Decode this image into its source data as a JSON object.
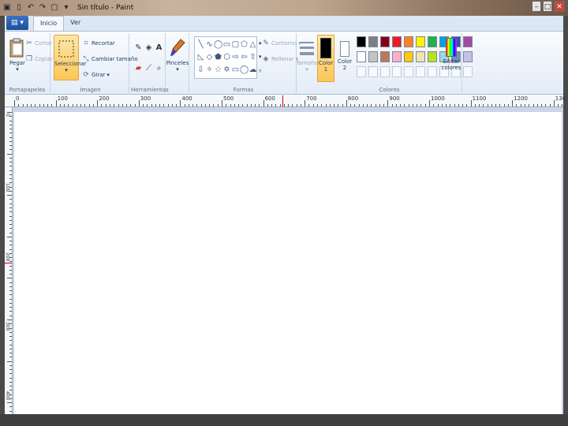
{
  "window": {
    "title": "Sin título - Paint",
    "controls": {
      "minimize": "–",
      "maximize": "□",
      "close": "✕"
    }
  },
  "tabs": {
    "file_icon": "▤ ▾",
    "items": [
      "Inicio",
      "Ver"
    ],
    "active": "Inicio"
  },
  "groups": {
    "clipboard": {
      "label": "Portapapeles",
      "paste": "Pegar",
      "cut": "Cortar",
      "copy": "Copiar"
    },
    "image": {
      "label": "Imagen",
      "select": "Seleccionar",
      "crop": "Recortar",
      "resize": "Cambiar tamaño",
      "rotate": "Girar"
    },
    "tools": {
      "label": "Herramientas"
    },
    "brushes": {
      "label": "Pinceles"
    },
    "shapes": {
      "label": "Formas",
      "outline": "Contorno",
      "fill": "Rellenar"
    },
    "size": {
      "label": "Tamaño"
    },
    "colors": {
      "label": "Colores",
      "color1": "Color 1",
      "color2": "Color 2",
      "edit": "Editar colores",
      "color1_value": "#000000",
      "color2_value": "#ffffff",
      "palette_row1": [
        "#000000",
        "#7f7f7f",
        "#880015",
        "#ed1c24",
        "#ff7f27",
        "#fff200",
        "#22b14c",
        "#00a2e8",
        "#3f48cc",
        "#a349a4"
      ],
      "palette_row2": [
        "#ffffff",
        "#c3c3c3",
        "#b97a57",
        "#ffaec9",
        "#ffc90e",
        "#efe4b0",
        "#b5e61d",
        "#99d9ea",
        "#7092be",
        "#c8bfe7"
      ]
    }
  },
  "ruler": {
    "top_labels": [
      "0",
      "100",
      "200",
      "300",
      "400",
      "500",
      "600",
      "700",
      "800",
      "900",
      "1000",
      "1100",
      "1200",
      "130"
    ],
    "left_labels": [
      "0",
      "100",
      "200",
      "300",
      "400"
    ]
  }
}
